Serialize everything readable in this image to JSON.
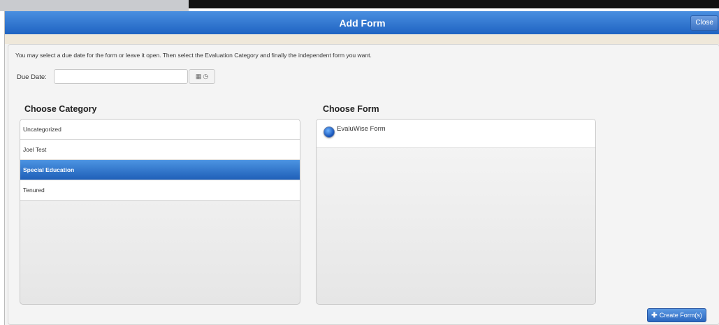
{
  "dialog": {
    "title": "Add Form",
    "close_label": "Close"
  },
  "instructions": "You may select a due date for the form or leave it open. Then select the Evaluation Category and finally the independent form you want.",
  "due_date": {
    "label": "Due Date:",
    "value": "",
    "calendar_icon": "calendar-icon",
    "clock_icon": "clock-icon"
  },
  "category": {
    "heading": "Choose Category",
    "items": [
      {
        "label": "Uncategorized",
        "selected": false
      },
      {
        "label": "Joel Test",
        "selected": false
      },
      {
        "label": "Special Education",
        "selected": true
      },
      {
        "label": "Tenured",
        "selected": false
      }
    ]
  },
  "form": {
    "heading": "Choose Form",
    "items": [
      {
        "label": "EvaluWise Form",
        "selected": true
      }
    ]
  },
  "create_button": {
    "label": "Create Form(s)",
    "icon": "plus-icon"
  },
  "colors": {
    "accent": "#1f63c2",
    "selected_row": "#2e74cf"
  }
}
